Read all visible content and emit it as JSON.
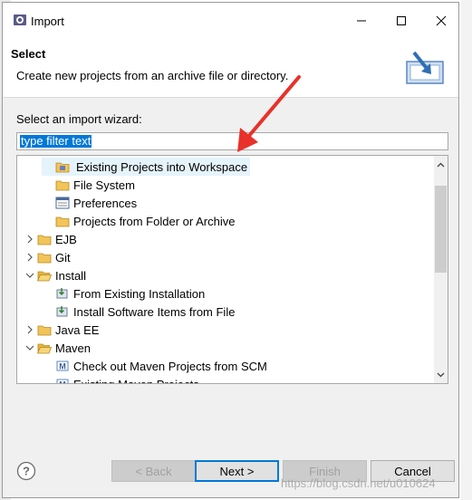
{
  "window": {
    "title": "Import"
  },
  "header": {
    "title": "Select",
    "description": "Create new projects from an archive file or directory."
  },
  "wizard": {
    "label": "Select an import wizard:",
    "filter_value": "type filter text"
  },
  "tree": [
    {
      "label": "Existing Projects into Workspace",
      "icon": "project-folder-icon",
      "level": 2,
      "highlighted": true
    },
    {
      "label": "File System",
      "icon": "folder-icon",
      "level": 2
    },
    {
      "label": "Preferences",
      "icon": "preferences-icon",
      "level": 2
    },
    {
      "label": "Projects from Folder or Archive",
      "icon": "folder-icon",
      "level": 2
    },
    {
      "label": "EJB",
      "icon": "folder-icon",
      "level": 1,
      "expander": "collapsed"
    },
    {
      "label": "Git",
      "icon": "folder-icon",
      "level": 1,
      "expander": "collapsed"
    },
    {
      "label": "Install",
      "icon": "folder-open-icon",
      "level": 1,
      "expander": "expanded"
    },
    {
      "label": "From Existing Installation",
      "icon": "install-icon",
      "level": 2
    },
    {
      "label": "Install Software Items from File",
      "icon": "install-icon",
      "level": 2
    },
    {
      "label": "Java EE",
      "icon": "folder-icon",
      "level": 1,
      "expander": "collapsed"
    },
    {
      "label": "Maven",
      "icon": "folder-open-icon",
      "level": 1,
      "expander": "expanded"
    },
    {
      "label": "Check out Maven Projects from SCM",
      "icon": "maven-icon",
      "level": 2
    },
    {
      "label": "Existing Maven Projects",
      "icon": "maven-icon",
      "level": 2
    }
  ],
  "buttons": {
    "back": "< Back",
    "next": "Next >",
    "finish": "Finish",
    "cancel": "Cancel"
  },
  "watermark": "https://blog.csdn.net/u010624",
  "colors": {
    "accent": "#0078d7",
    "folder": "#f2c45a",
    "annotation_arrow": "#e8312a"
  }
}
